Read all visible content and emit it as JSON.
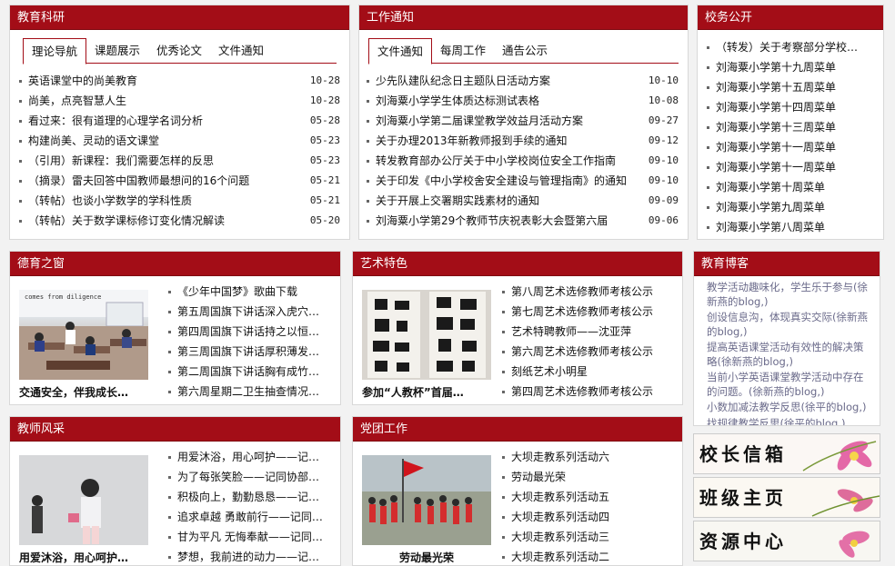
{
  "research": {
    "title": "教育科研",
    "tabs": [
      "理论导航",
      "课题展示",
      "优秀论文",
      "文件通知"
    ],
    "items": [
      {
        "t": "英语课堂中的尚美教育",
        "d": "10-28"
      },
      {
        "t": "尚美，点亮智慧人生",
        "d": "10-28"
      },
      {
        "t": "看过来：很有道理的心理学名词分析",
        "d": "05-28"
      },
      {
        "t": "构建尚美、灵动的语文课堂",
        "d": "05-23"
      },
      {
        "t": "（引用）新课程：我们需要怎样的反思",
        "d": "05-23"
      },
      {
        "t": "（摘录）雷夫回答中国教师最想问的16个问题",
        "d": "05-21"
      },
      {
        "t": "（转帖）也谈小学数学的学科性质",
        "d": "05-21"
      },
      {
        "t": "（转帖）关于数学课标修订变化情况解读",
        "d": "05-20"
      }
    ]
  },
  "notice": {
    "title": "工作通知",
    "tabs": [
      "文件通知",
      "每周工作",
      "通告公示"
    ],
    "items": [
      {
        "t": "少先队建队纪念日主题队日活动方案",
        "d": "10-10"
      },
      {
        "t": "刘海粟小学学生体质达标测试表格",
        "d": "10-08"
      },
      {
        "t": "刘海粟小学第二届课堂教学效益月活动方案",
        "d": "09-27"
      },
      {
        "t": "关于办理2013年新教师报到手续的通知",
        "d": "09-12"
      },
      {
        "t": "转发教育部办公厅关于中小学校岗位安全工作指南",
        "d": "09-10"
      },
      {
        "t": "关于印发《中小学校舍安全建设与管理指南》的通知",
        "d": "09-10"
      },
      {
        "t": "关于开展上交署期实践素材的通知",
        "d": "09-09"
      },
      {
        "t": "刘海粟小学第29个教师节庆祝表彰大会暨第六届",
        "d": "09-06"
      }
    ]
  },
  "affairs": {
    "title": "校务公开",
    "items": [
      "（转发）关于考察部分学校…",
      "刘海粟小学第十九周菜单",
      "刘海粟小学第十五周菜单",
      "刘海粟小学第十四周菜单",
      "刘海粟小学第十三周菜单",
      "刘海粟小学第十一周菜单",
      "刘海粟小学第十一周菜单",
      "刘海粟小学第十周菜单",
      "刘海粟小学第九周菜单",
      "刘海粟小学第八周菜单"
    ]
  },
  "moral": {
    "title": "德育之窗",
    "caption": "交通安全，伴我成长…",
    "photo_text": "comes from diligence",
    "items": [
      "《少年中国梦》歌曲下载",
      "第五周国旗下讲话深入虎穴…",
      "第四周国旗下讲话持之以恒…",
      "第三周国旗下讲话厚积薄发…",
      "第二周国旗下讲话胸有成竹…",
      "第六周星期二卫生抽查情况…"
    ]
  },
  "art": {
    "title": "艺术特色",
    "caption": "参加“人教杯”首届…",
    "items": [
      "第八周艺术选修教师考核公示",
      "第七周艺术选修教师考核公示",
      "艺术特聘教师——沈亚萍",
      "第六周艺术选修教师考核公示",
      "刻纸艺术小明星",
      "第四周艺术选修教师考核公示"
    ]
  },
  "blog": {
    "title": "教育博客",
    "entries": [
      "教学活动趣味化，学生乐于参与(徐新燕的blog,)",
      "创设信息沟，体现真实交际(徐新燕的blog,)",
      "提高英语课堂活动有效性的解决策略(徐新燕的blog,)",
      "当前小学英语课堂教学活动中存在的问题。(徐新燕的blog,)",
      "小数加减法教学反思(徐平的blog,)",
      "找规律教学反思(徐平的blog,)"
    ]
  },
  "teachers": {
    "title": "教师风采",
    "caption": "用爱沐浴，用心呵护…",
    "items": [
      "用爱沐浴，用心呵护——记…",
      "为了每张笑脸——记同协部…",
      "积极向上，勤勤恳恳——记…",
      "追求卓越 勇敢前行——记同…",
      "甘为平凡 无悔奉献——记同…",
      "梦想，我前进的动力——记…"
    ]
  },
  "party": {
    "title": "党团工作",
    "caption": "劳动最光荣",
    "items": [
      "大坝走教系列活动六",
      "劳动最光荣",
      "大坝走教系列活动五",
      "大坝走教系列活动四",
      "大坝走教系列活动三",
      "大坝走教系列活动二"
    ]
  },
  "banners": [
    "校长信箱",
    "班级主页",
    "资源中心"
  ],
  "colors": {
    "header": "#a30d17",
    "accent_flower": "#d63a8a"
  }
}
